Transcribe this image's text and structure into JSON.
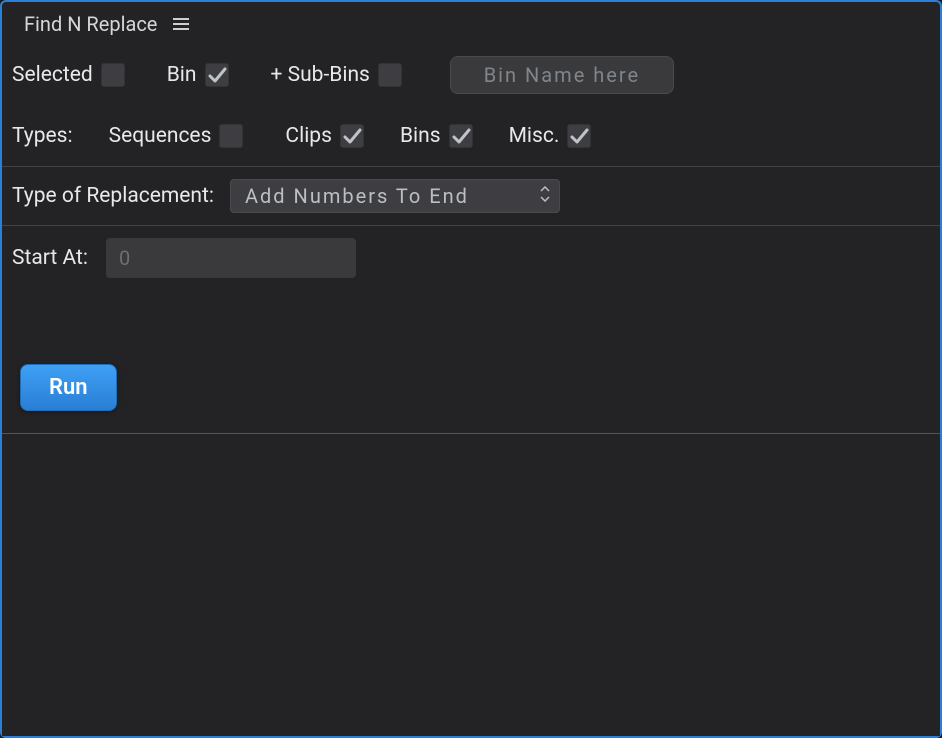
{
  "header": {
    "title": "Find N Replace"
  },
  "source": {
    "selected": {
      "label": "Selected",
      "checked": false
    },
    "bin": {
      "label": "Bin",
      "checked": true
    },
    "subbins": {
      "label": "+ Sub-Bins",
      "checked": false
    },
    "bin_name": {
      "value": "",
      "placeholder": "Bin Name here"
    }
  },
  "types": {
    "label": "Types:",
    "sequences": {
      "label": "Sequences",
      "checked": false
    },
    "clips": {
      "label": "Clips",
      "checked": true
    },
    "bins": {
      "label": "Bins",
      "checked": true
    },
    "misc": {
      "label": "Misc.",
      "checked": true
    }
  },
  "replacement": {
    "label": "Type of Replacement:",
    "selected": "Add Numbers To End"
  },
  "start_at": {
    "label": "Start At:",
    "value": "",
    "placeholder": "0"
  },
  "actions": {
    "run": "Run"
  },
  "colors": {
    "accent": "#2b7fd9",
    "panel_bg": "#232325",
    "control_bg": "#3e3e42"
  }
}
